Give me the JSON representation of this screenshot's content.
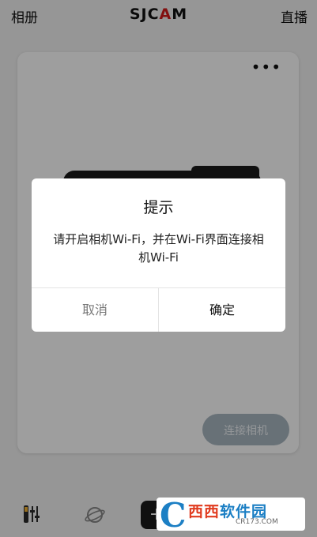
{
  "topbar": {
    "left_label": "相册",
    "brand_prefix": "SJC",
    "brand_accent": "A",
    "brand_suffix": "M",
    "right_label": "直播"
  },
  "card": {
    "more_label": "•••",
    "connect_button": "连接相机"
  },
  "bottom": {
    "icons": [
      "tool-icon",
      "planet-icon"
    ],
    "add_label": "+"
  },
  "dialog": {
    "title": "提示",
    "message": "请开启相机Wi-Fi，并在Wi-Fi界面连接相机Wi-Fi",
    "cancel_label": "取消",
    "ok_label": "确定"
  },
  "watermark": {
    "mark": "C",
    "title_red": "西西",
    "title_blue": "软件园",
    "subtitle": "CR173.COM"
  },
  "colors": {
    "accent": "#d21a1a",
    "connect_button_bg": "#a9b6c1",
    "watermark_blue": "#1c7fc4"
  }
}
